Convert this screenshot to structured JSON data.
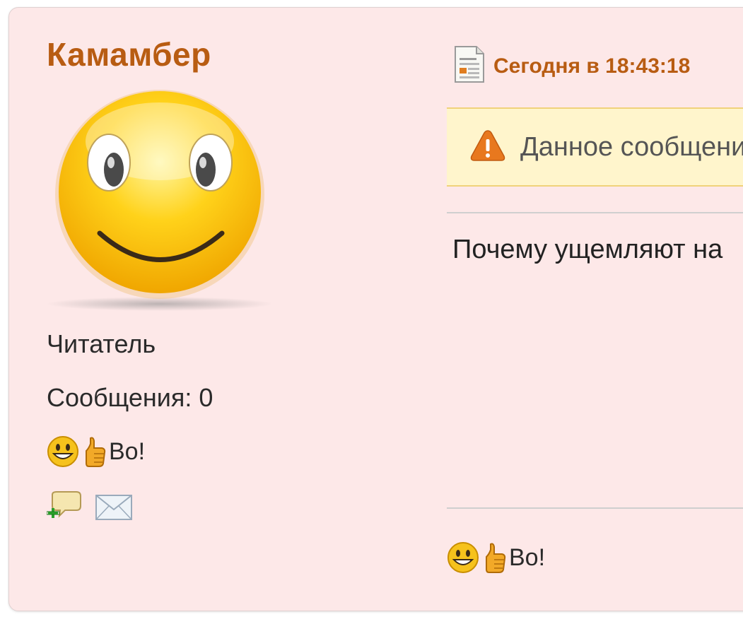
{
  "user": {
    "name": "Камамбер",
    "role": "Читатель",
    "posts_label": "Сообщения: 0",
    "signature_text": "Во!",
    "avatar_icon": "smiley-avatar-icon",
    "actions": [
      {
        "icon": "add-chat-icon"
      },
      {
        "icon": "envelope-icon"
      }
    ]
  },
  "post": {
    "date_icon": "document-icon",
    "date": "Сегодня в 18:43:18",
    "warning_icon": "warning-icon",
    "warning_text": "Данное сообщение",
    "body": "Почему ущемляют на",
    "signature_text": "Во!"
  },
  "colors": {
    "card_bg": "#fde8e8",
    "username": "#b85c12",
    "warning_bg": "#fff5cc",
    "warning_border": "#f0d27a"
  }
}
